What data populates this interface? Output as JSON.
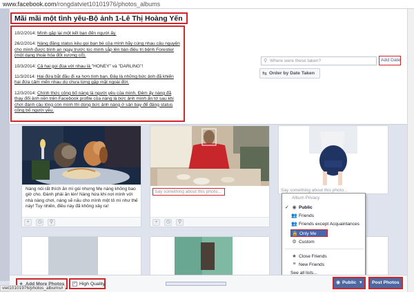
{
  "browser": {
    "url_domain": "www.facebook.com",
    "url_path": "/rongdatviet10101976/photos_albums",
    "status_url": "viet10101976/photos_albums#"
  },
  "album": {
    "title": "Mãi mãi một tình yêu-Bộ ảnh 1-Lê Thị Hoàng Yến",
    "description": [
      {
        "parts": [
          {
            "t": "10/2/2014: ",
            "u": false
          },
          {
            "t": "Mình gặp lại một kết bạn đến người ấy.",
            "u": true
          }
        ]
      },
      {
        "parts": [
          {
            "t": "26/2/2014: ",
            "u": false
          },
          {
            "t": "Nàng đăng status kêu gọi bạn bè của mình hãy cùng nhau câu nguyện cho mình được bình an ngay trước lúc mình sắp lên bàn điều trị bệnh Forestier (một dạng thoái hóa đốt xương cổ).",
            "u": true
          }
        ]
      },
      {
        "parts": [
          {
            "t": "10/3/2014: ",
            "u": false
          },
          {
            "t": "Cả hai gọi đùa với nhau là ",
            "u": true
          },
          {
            "t": "\"HONEY\" và \"DARLING\"!",
            "u": false
          }
        ]
      },
      {
        "parts": [
          {
            "t": "11/3/2014: ",
            "u": false
          },
          {
            "t": "Hai đứa bắt đầu đi xa hơn tình bạn. Đây là những bức ảnh đã khiến hai đứa cảm mến nhau dù chưa từng gặp mặt ngoài đời.",
            "u": true
          }
        ]
      },
      {
        "parts": [
          {
            "t": "12/3/2014: ",
            "u": false
          },
          {
            "t": "Chính thức công bố nàng là người yêu của mình. Đêm ấy nàng đã thay đổi ảnh nền trên Facebook profile của nàng là bức ảnh mình ấn tớ sau khi chơi đánh cầu lông còn mình thì dùng bức ảnh nàng ở sân bay để đăng status công bố người yêu.",
            "u": true
          }
        ]
      }
    ]
  },
  "toolbar": {
    "where_placeholder": "Where were these taken?",
    "add_date": "Add Date",
    "order_by_date": "Order by Date Taken"
  },
  "photos": [
    {
      "caption": "Nàng nói rất thích ăn mì gói nhưng Mẹ nàng không bao giờ cho. Đành phải ăn lén! Nàng hứa khi nơi mình với nhà nàng chơi, nàng sẽ nấu cho mình một tô mì như thế này! Tuy nhiên, điều này đã không xảy ra!"
    },
    {
      "caption_placeholder": "Say something about this photo..."
    },
    {
      "caption_placeholder": "Say something about this photo..."
    }
  ],
  "privacy_menu": {
    "header": "Album Privacy",
    "items": [
      {
        "label": "Public",
        "icon": "globe-icon",
        "checked": true,
        "bold": true
      },
      {
        "label": "Friends",
        "icon": "friends-icon",
        "checked": false,
        "bold": false
      },
      {
        "label": "Friends except Acquaintances",
        "icon": "friends-except-icon",
        "checked": false,
        "bold": false
      },
      {
        "label": "Only Me",
        "icon": "lock-icon",
        "checked": false,
        "bold": false,
        "selected": true
      },
      {
        "label": "Custom",
        "icon": "gear-icon",
        "checked": false,
        "bold": false
      },
      {
        "label": "Close Friends",
        "icon": "star-list-icon",
        "checked": false,
        "bold": false
      },
      {
        "label": "New Friends",
        "icon": "list-icon",
        "checked": false,
        "bold": false
      },
      {
        "label": "See all lists...",
        "icon": "",
        "checked": false,
        "bold": false
      }
    ]
  },
  "bottom": {
    "add_more_photos": "Add More Photos",
    "high_quality": "High Quality",
    "high_quality_checked": true,
    "upload_progress": 0.0,
    "privacy_button": "Public",
    "post_photos": "Post Photos"
  },
  "colors": {
    "facebook_blue": "#4e69a2",
    "annotation_red": "#d0262b",
    "link_blue": "#3b5998"
  }
}
